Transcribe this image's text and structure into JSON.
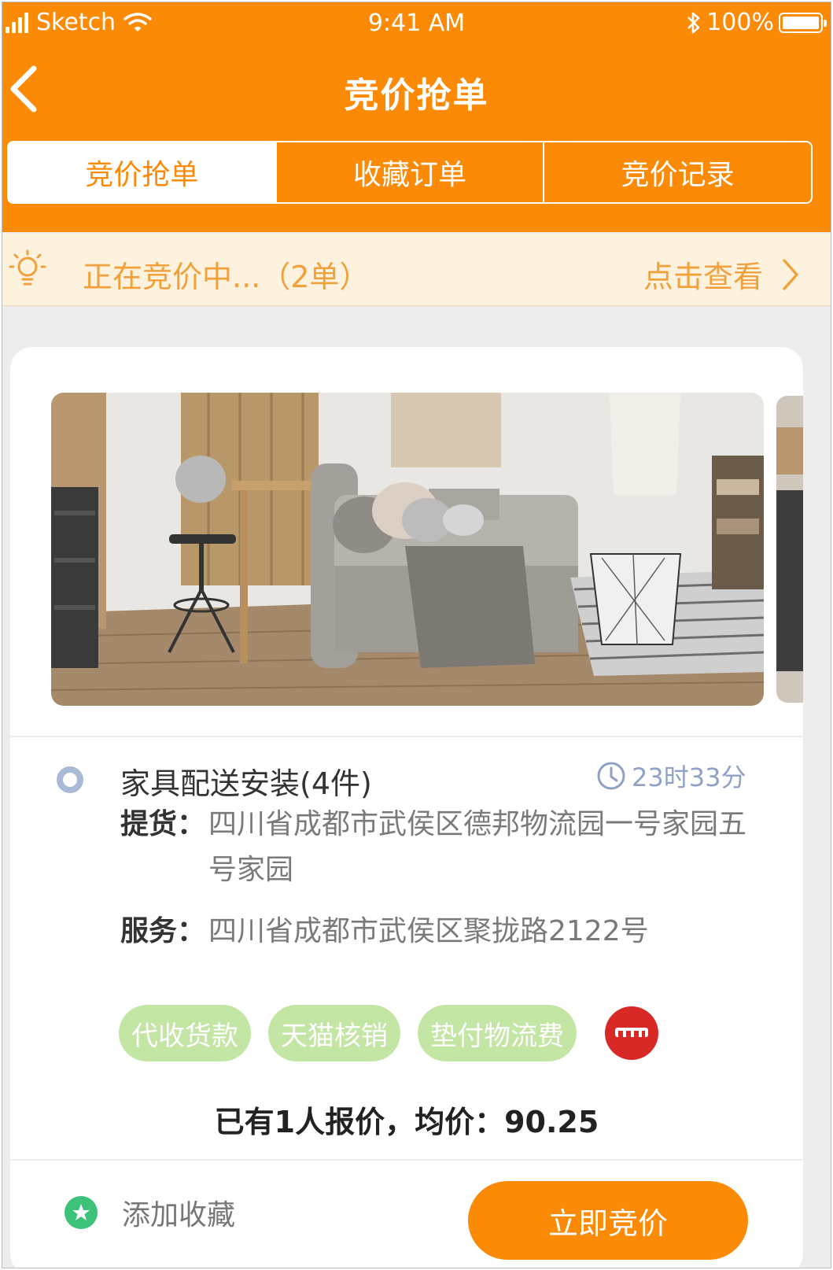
{
  "status_bar": {
    "carrier": "Sketch",
    "time": "9:41 AM",
    "battery": "100%"
  },
  "nav": {
    "title": "竞价抢单"
  },
  "tabs": [
    {
      "label": "竞价抢单",
      "active": true
    },
    {
      "label": "收藏订单",
      "active": false
    },
    {
      "label": "竞价记录",
      "active": false
    }
  ],
  "notice": {
    "text": "正在竞价中...（2单）",
    "link": "点击查看"
  },
  "order": {
    "title": "家具配送安装(4件)",
    "timer": "23时33分",
    "pickup_label": "提货：",
    "pickup_value": "四川省成都市武侯区德邦物流园一号家园五号家园",
    "service_label": "服务：",
    "service_value": "四川省成都市武侯区聚拢路2122号",
    "tags": [
      "代收货款",
      "天猫核销",
      "垫付物流费"
    ],
    "quote": "已有1人报价，均价：90.25",
    "favorite_label": "添加收藏",
    "bid_button": "立即竞价"
  },
  "colors": {
    "brand_orange": "#fb8a07",
    "notice_bg": "#fdf2dd",
    "notice_text": "#f1a13c",
    "tag_green": "#c4e6a4",
    "favorite_green": "#3dc27a",
    "tmall_red": "#d92927",
    "timer_blue": "#8fa2c4"
  },
  "icons": [
    "signal-icon",
    "wifi-icon",
    "bluetooth-icon",
    "battery-icon",
    "back-icon",
    "bulb-icon",
    "chevron-right-icon",
    "radio-icon",
    "clock-icon",
    "tmall-icon",
    "star-icon"
  ]
}
